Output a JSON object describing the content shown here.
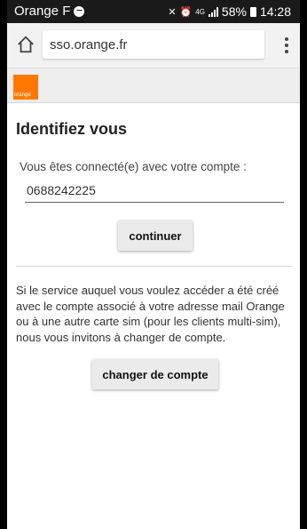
{
  "status_bar": {
    "carrier": "Orange F",
    "network": "4G",
    "battery": "58%",
    "time": "14:28"
  },
  "browser": {
    "url": "sso.orange.fr"
  },
  "brand": {
    "logo_text": "orange",
    "color": "#ff7900"
  },
  "page": {
    "title": "Identifiez vous",
    "connected_label": "Vous êtes connecté(e) avec votre compte :",
    "account_number": "0688242225",
    "continue_label": "continuer",
    "info_text": "Si le service auquel vous voulez accéder a été créé avec le compte associé à votre adresse mail Orange ou à une autre carte sim (pour les clients multi-sim), nous vous invitons à changer de compte.",
    "change_account_label": "changer de compte"
  }
}
